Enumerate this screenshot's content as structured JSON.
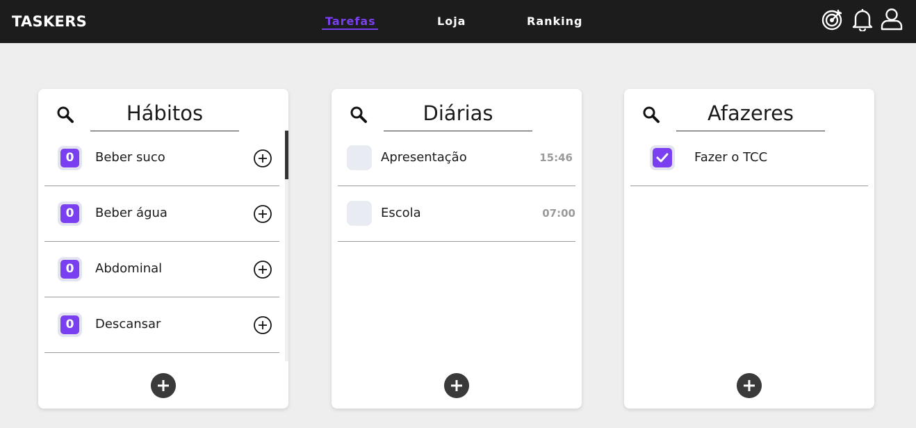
{
  "app": {
    "logo": "TASKERS"
  },
  "nav": {
    "items": [
      {
        "label": "Tarefas",
        "active": true
      },
      {
        "label": "Loja",
        "active": false
      },
      {
        "label": "Ranking",
        "active": false
      }
    ]
  },
  "header_icons": [
    "target-icon",
    "bell-icon",
    "user-icon"
  ],
  "colors": {
    "accent": "#7a3ff0",
    "topbar": "#1c1c1c",
    "background": "#eeeeee"
  },
  "habits": {
    "title": "Hábitos",
    "items": [
      {
        "count": "0",
        "label": "Beber suco"
      },
      {
        "count": "0",
        "label": "Beber água"
      },
      {
        "count": "0",
        "label": "Abdominal"
      },
      {
        "count": "0",
        "label": "Descansar"
      }
    ]
  },
  "dailies": {
    "title": "Diárias",
    "items": [
      {
        "label": "Apresentação",
        "time": "15:46",
        "checked": false
      },
      {
        "label": "Escola",
        "time": "07:00",
        "checked": false
      }
    ]
  },
  "todos": {
    "title": "Afazeres",
    "items": [
      {
        "label": "Fazer o TCC",
        "checked": true
      }
    ]
  }
}
